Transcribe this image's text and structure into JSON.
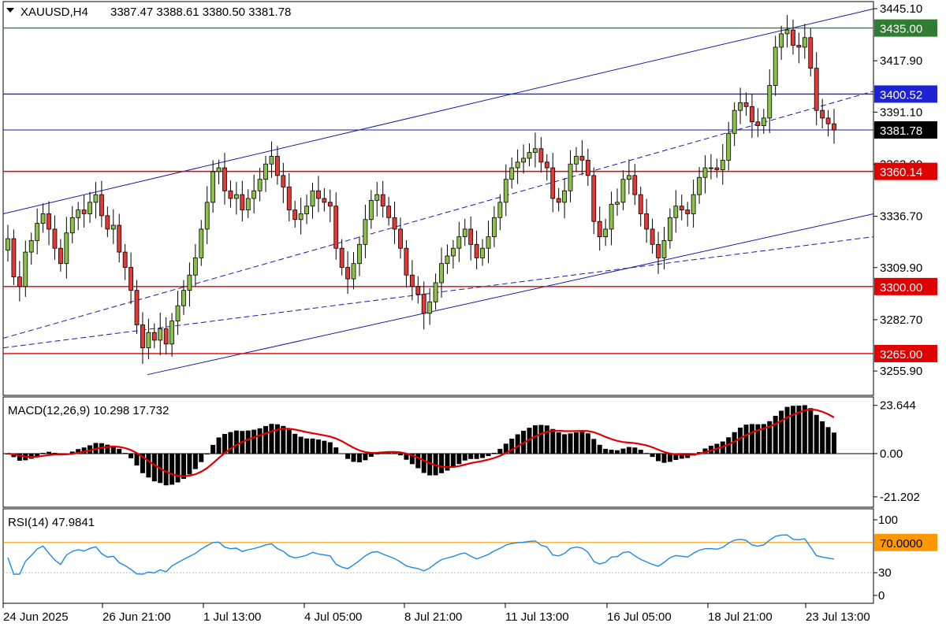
{
  "header": {
    "symbol": "XAUUSD,H4",
    "ohlc": "3387.47 3388.61 3380.50 3381.78"
  },
  "colors": {
    "bull": "#8bc34a",
    "bear": "#e53935",
    "channel": "#1a1aa6",
    "resistance_green": "#2e7d32",
    "level_blue": "#1e22d6",
    "level_red": "#e00000",
    "macd_signal": "#e00000",
    "rsi_line": "#1e88e5",
    "rsi_level": "#ff9800"
  },
  "chart_data": [
    {
      "type": "candlestick",
      "title": "XAUUSD,H4",
      "x_ticks": [
        "24 Jun 2025",
        "26 Jun 21:00",
        "1 Jul 13:00",
        "4 Jul 05:00",
        "8 Jul 21:00",
        "11 Jul 13:00",
        "16 Jul 05:00",
        "18 Jul 21:00",
        "23 Jul 13:00"
      ],
      "y_ticks": [
        3445.1,
        3417.9,
        3391.1,
        3363.9,
        3336.7,
        3309.9,
        3282.7,
        3255.9
      ],
      "ylim": [
        3244.0,
        3448.0
      ],
      "current_price": 3381.78,
      "levels": [
        {
          "value": 3435.0,
          "label": "3435.00",
          "color": "green"
        },
        {
          "value": 3400.52,
          "label": "3400.52",
          "color": "blue"
        },
        {
          "value": 3360.14,
          "label": "3360.14",
          "color": "red"
        },
        {
          "value": 3300.0,
          "label": "3300.00",
          "color": "red"
        },
        {
          "value": 3265.0,
          "label": "3265.00",
          "color": "red"
        }
      ],
      "closes": [
        3325,
        3305,
        3300,
        3318,
        3324,
        3333,
        3338,
        3330,
        3320,
        3312,
        3328,
        3336,
        3340,
        3338,
        3344,
        3348,
        3337,
        3330,
        3332,
        3318,
        3310,
        3298,
        3280,
        3268,
        3276,
        3272,
        3278,
        3270,
        3282,
        3290,
        3298,
        3306,
        3315,
        3330,
        3344,
        3360,
        3362,
        3350,
        3346,
        3348,
        3340,
        3346,
        3350,
        3356,
        3364,
        3368,
        3358,
        3352,
        3340,
        3335,
        3338,
        3342,
        3350,
        3346,
        3344,
        3342,
        3320,
        3310,
        3304,
        3312,
        3322,
        3335,
        3345,
        3348,
        3342,
        3336,
        3330,
        3320,
        3306,
        3300,
        3296,
        3286,
        3292,
        3302,
        3312,
        3316,
        3320,
        3326,
        3330,
        3322,
        3315,
        3320,
        3326,
        3336,
        3344,
        3356,
        3362,
        3365,
        3367,
        3370,
        3372,
        3365,
        3362,
        3346,
        3344,
        3350,
        3364,
        3368,
        3366,
        3358,
        3334,
        3326,
        3330,
        3343,
        3344,
        3356,
        3358,
        3348,
        3338,
        3330,
        3322,
        3315,
        3324,
        3336,
        3342,
        3340,
        3338,
        3348,
        3357,
        3362,
        3362,
        3361,
        3366,
        3380,
        3392,
        3396,
        3394,
        3386,
        3384,
        3388,
        3405,
        3425,
        3432,
        3434,
        3426,
        3425,
        3430,
        3414,
        3392,
        3388,
        3385,
        3381.78
      ],
      "x_range": [
        "24 Jun 2025",
        "23 Jul 13:00"
      ]
    },
    {
      "type": "bar",
      "title": "MACD(12,26,9) 10.298 17.732",
      "y_ticks": [
        23.644,
        0.0,
        -21.202
      ],
      "ylim": [
        -25.5,
        27.0
      ],
      "macd_values": 10.298,
      "signal_value": 17.732
    },
    {
      "type": "line",
      "title": "RSI(14) 47.9841",
      "y_ticks": [
        100,
        70.0,
        30,
        0
      ],
      "ylim": [
        0,
        100
      ],
      "levels": [
        70,
        30
      ],
      "current_value": 47.9841
    }
  ]
}
